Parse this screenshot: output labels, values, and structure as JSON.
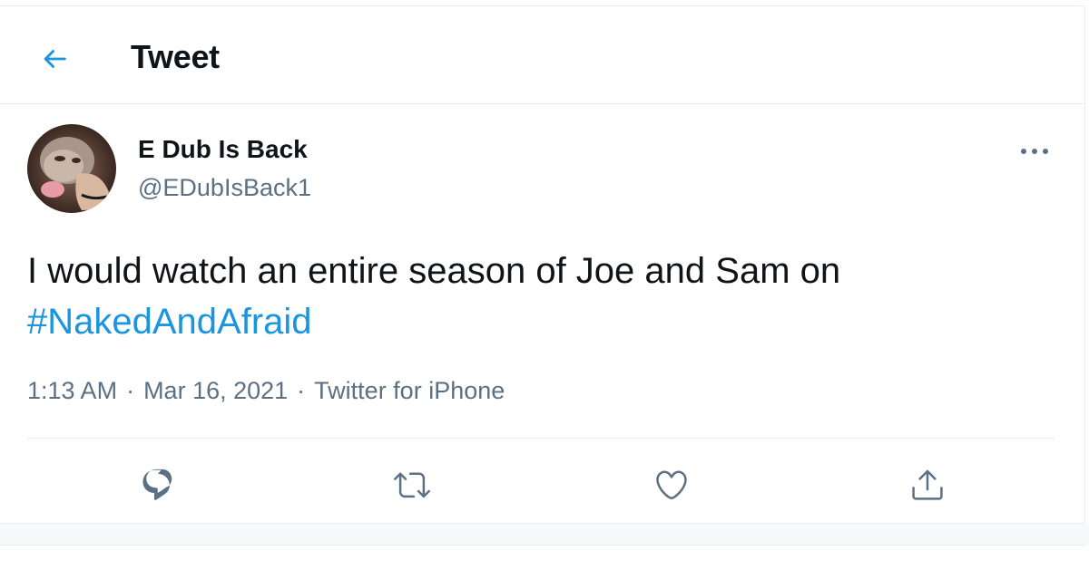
{
  "header": {
    "title": "Tweet",
    "back_icon": "arrow-left-icon"
  },
  "author": {
    "display_name": "E Dub Is Back",
    "handle": "@EDubIsBack1",
    "avatar_description_icon": "avatar-image"
  },
  "tweet": {
    "text": "I would watch an entire season of Joe and Sam on",
    "hashtag": "#NakedAndAfraid"
  },
  "meta": {
    "time": "1:13 AM",
    "separator": "·",
    "date": "Mar 16, 2021",
    "source": "Twitter for iPhone"
  },
  "actions": [
    {
      "icon": "reply-icon"
    },
    {
      "icon": "retweet-icon"
    },
    {
      "icon": "like-icon"
    },
    {
      "icon": "share-icon"
    }
  ],
  "colors": {
    "accent": "#1b95e0",
    "text": "#0f1419",
    "secondary": "#5b7083",
    "border": "#e6ecf0"
  }
}
